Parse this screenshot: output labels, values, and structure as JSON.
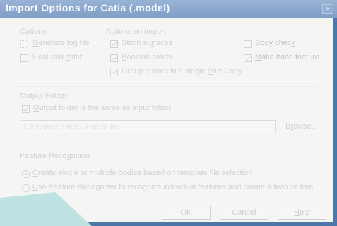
{
  "window": {
    "title": "Import Options for Catia (.model)",
    "close_glyph": "×"
  },
  "options_group": {
    "title": "Options",
    "items": [
      {
        "label_pre": "",
        "label_u": "G",
        "label_post": "enerate log file",
        "checked": false
      },
      {
        "label_pre": "Heal and ",
        "label_u": "s",
        "label_post": "titch",
        "checked": false
      }
    ]
  },
  "actions_group": {
    "title": "Actions on import",
    "items": [
      {
        "label_pre": "Stitch su",
        "label_u": "r",
        "label_post": "faces",
        "checked": true
      },
      {
        "label_pre": "",
        "label_u": "B",
        "label_post": "oolean solids",
        "checked": true
      },
      {
        "label_pre": "Group curves in a single ",
        "label_u": "P",
        "label_post": "art Copy",
        "checked": true
      }
    ],
    "right_items": [
      {
        "label_pre": "Body chec",
        "label_u": "k",
        "label_post": "",
        "checked": false
      },
      {
        "label_pre": "",
        "label_u": "M",
        "label_post": "ake base feature",
        "checked": true
      }
    ]
  },
  "output_folder": {
    "title": "Output Folder",
    "checkbox_label_pre": "",
    "checkbox_label_u": "O",
    "checkbox_label_post": "utput folder is the same as input folder",
    "checked": true,
    "path_value": "C:\\Program Files\\...\\Parts\\Files",
    "browse_label_pre": "B",
    "browse_label_u": "r",
    "browse_label_post": "owse..."
  },
  "feature_recognition": {
    "title": "Feature Recognition",
    "options": [
      {
        "label_pre": "",
        "label_u": "C",
        "label_post": "reate single or multiple bodies based on template file selection",
        "selected": true
      },
      {
        "label_pre": "",
        "label_u": "U",
        "label_post": "se Feature Recognizer to recognize individual features and create a feature tree",
        "selected": false
      }
    ]
  },
  "buttons": {
    "ok": "OK",
    "cancel": "Cancel",
    "help_u": "H",
    "help_post": "elp"
  },
  "colors": {
    "titlebar": "#8aa7cd",
    "frame": "#4f76a8",
    "teal": "#b9e0e0"
  }
}
